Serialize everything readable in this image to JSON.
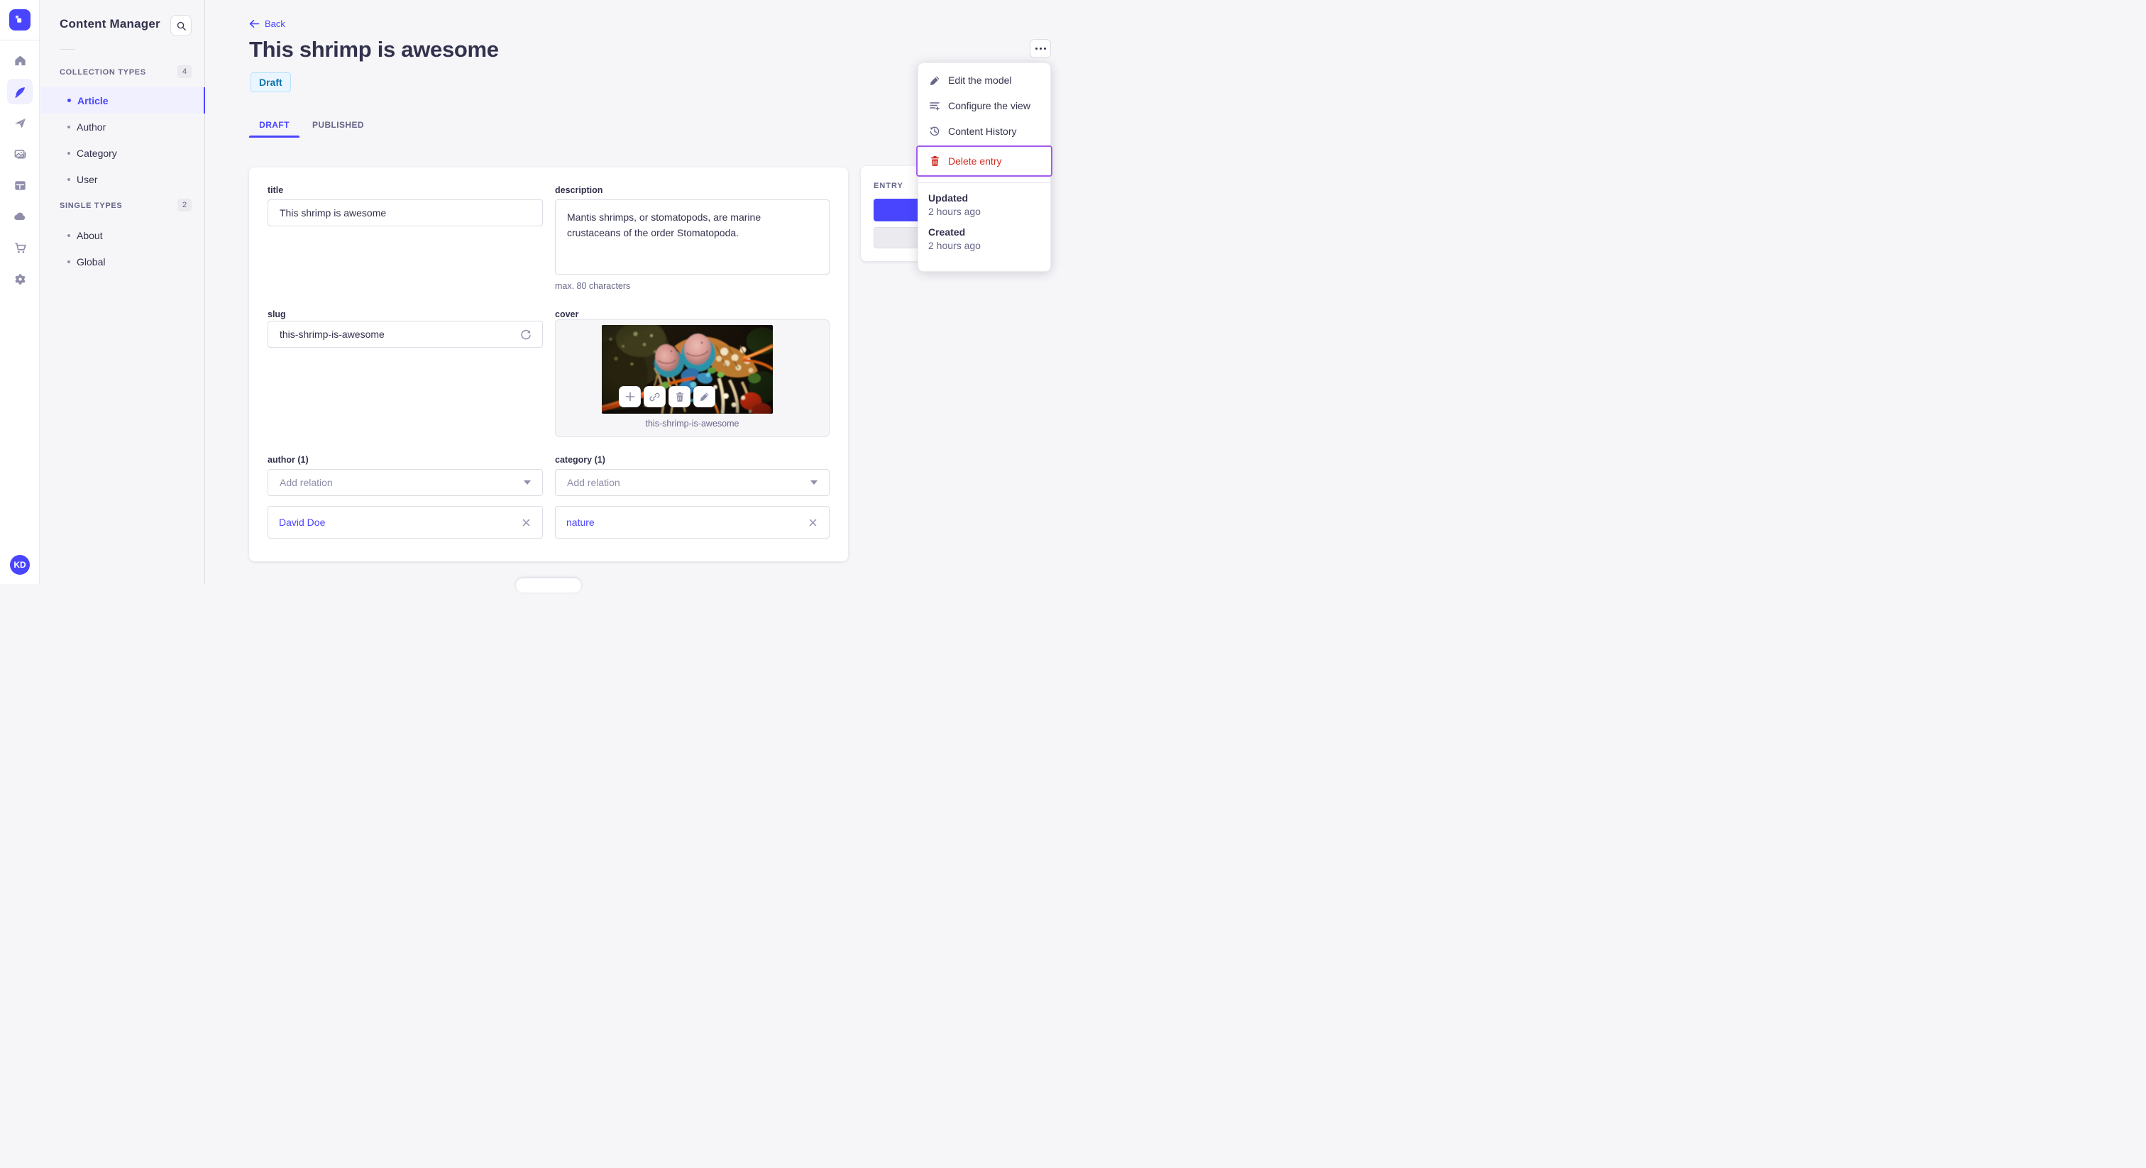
{
  "colors": {
    "primary": "#4945FF",
    "primary_light": "#F0F0FF",
    "danger": "#D02B20",
    "menu_highlight": "#A35BEB",
    "draft_bg": "#EAF5FF",
    "draft_border": "#B8E1FF",
    "draft_text": "#0C75AF"
  },
  "rail": {
    "avatar_initials": "KD"
  },
  "subnav": {
    "title": "Content Manager",
    "sections": [
      {
        "label": "COLLECTION TYPES",
        "count": "4",
        "items": [
          {
            "label": "Article"
          },
          {
            "label": "Author"
          },
          {
            "label": "Category"
          },
          {
            "label": "User"
          }
        ]
      },
      {
        "label": "SINGLE TYPES",
        "count": "2",
        "items": [
          {
            "label": "About"
          },
          {
            "label": "Global"
          }
        ]
      }
    ]
  },
  "header": {
    "back_label": "Back",
    "title": "This shrimp is awesome",
    "status_badge": "Draft",
    "tabs": [
      {
        "label": "DRAFT"
      },
      {
        "label": "PUBLISHED"
      }
    ]
  },
  "form": {
    "title_field": {
      "label": "title",
      "value": "This shrimp is awesome"
    },
    "description_field": {
      "label": "description",
      "value": "Mantis shrimps, or stomatopods, are marine crustaceans of the order Stomatopoda.",
      "hint": "max. 80 characters"
    },
    "slug_field": {
      "label": "slug",
      "value": "this-shrimp-is-awesome"
    },
    "cover_field": {
      "label": "cover",
      "filename": "this-shrimp-is-awesome"
    },
    "author_field": {
      "label": "author (1)",
      "placeholder": "Add relation",
      "relation": "David Doe"
    },
    "category_field": {
      "label": "category (1)",
      "placeholder": "Add relation",
      "relation": "nature"
    }
  },
  "entry_panel": {
    "title": "ENTRY"
  },
  "context_menu": {
    "items": [
      {
        "label": "Edit the model"
      },
      {
        "label": "Configure the view"
      },
      {
        "label": "Content History"
      },
      {
        "label": "Delete entry"
      }
    ],
    "meta": [
      {
        "label": "Updated",
        "value": "2 hours ago"
      },
      {
        "label": "Created",
        "value": "2 hours ago"
      }
    ]
  }
}
